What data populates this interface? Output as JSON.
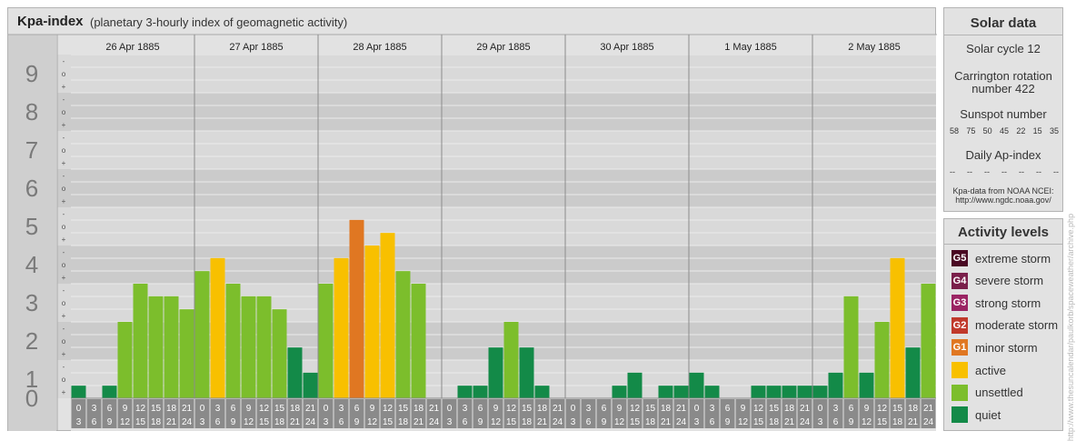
{
  "header": {
    "title": "Kpa-index",
    "subtitle": "(planetary 3-hourly index of geomagnetic activity)"
  },
  "chart_data": {
    "type": "bar",
    "ylim": [
      0,
      9
    ],
    "y_tick_labels": [
      "0",
      "1",
      "2",
      "3",
      "4",
      "5",
      "6",
      "7",
      "8",
      "9"
    ],
    "sub_tick_labels": [
      "+",
      "o",
      "-"
    ],
    "days": [
      "26 Apr 1885",
      "27 Apr 1885",
      "28 Apr 1885",
      "29 Apr 1885",
      "30 Apr 1885",
      "1 May 1885",
      "2 May 1885"
    ],
    "interval_start_labels": [
      "0",
      "3",
      "6",
      "9",
      "12",
      "15",
      "18",
      "21"
    ],
    "interval_end_labels": [
      "3",
      "6",
      "9",
      "12",
      "15",
      "18",
      "21",
      "24"
    ],
    "values": [
      0.33,
      0,
      0.33,
      2,
      3,
      2.67,
      2.67,
      2.33,
      3.33,
      3.67,
      3,
      2.67,
      2.67,
      2.33,
      1.33,
      0.67,
      3,
      3.67,
      4.67,
      4,
      4.33,
      3.33,
      3,
      0,
      0,
      0.33,
      0.33,
      1.33,
      2,
      1.33,
      0.33,
      0,
      0,
      0,
      0,
      0.33,
      0.67,
      0,
      0.33,
      0.33,
      0.67,
      0.33,
      0,
      0,
      0.33,
      0.33,
      0.33,
      0.33,
      0.33,
      0.67,
      2.67,
      0.67,
      2,
      3.67,
      1.33,
      3
    ],
    "levels": [
      {
        "max": 1.9,
        "color": "#138a48"
      },
      {
        "max": 3.4,
        "color": "#7cbe2c"
      },
      {
        "max": 4.4,
        "color": "#f8c000"
      },
      {
        "max": 5.4,
        "color": "#e07722"
      },
      {
        "max": 6.4,
        "color": "#c0392b"
      },
      {
        "max": 7.4,
        "color": "#9b2463"
      },
      {
        "max": 8.4,
        "color": "#7a1f4a"
      },
      {
        "max": 9,
        "color": "#4a0a23"
      }
    ]
  },
  "solar": {
    "title": "Solar data",
    "cycle": "Solar cycle 12",
    "carrington_line1": "Carrington rotation",
    "carrington_line2": "number 422",
    "sunspot_title": "Sunspot number",
    "sunspot_values": [
      "58",
      "75",
      "50",
      "45",
      "22",
      "15",
      "35"
    ],
    "ap_title": "Daily Ap-index",
    "ap_values": [
      "--",
      "--",
      "--",
      "--",
      "--",
      "--",
      "--"
    ],
    "source_line1": "Kpa-data from NOAA NCEI:",
    "source_line2": "http://www.ngdc.noaa.gov/"
  },
  "activity": {
    "title": "Activity levels",
    "levels": [
      {
        "badge": "G5",
        "label": "extreme storm",
        "color": "#4a0a23"
      },
      {
        "badge": "G4",
        "label": "severe storm",
        "color": "#7a1f4a"
      },
      {
        "badge": "G3",
        "label": "strong storm",
        "color": "#9b2463"
      },
      {
        "badge": "G2",
        "label": "moderate storm",
        "color": "#c0392b"
      },
      {
        "badge": "G1",
        "label": "minor storm",
        "color": "#e07722"
      },
      {
        "badge": "",
        "label": "active",
        "color": "#f8c000"
      },
      {
        "badge": "",
        "label": "unsettled",
        "color": "#7cbe2c"
      },
      {
        "badge": "",
        "label": "quiet",
        "color": "#138a48"
      }
    ]
  },
  "watermark": "http://www.thesuncalendar/paulkorb/spaceweather/archive.php"
}
